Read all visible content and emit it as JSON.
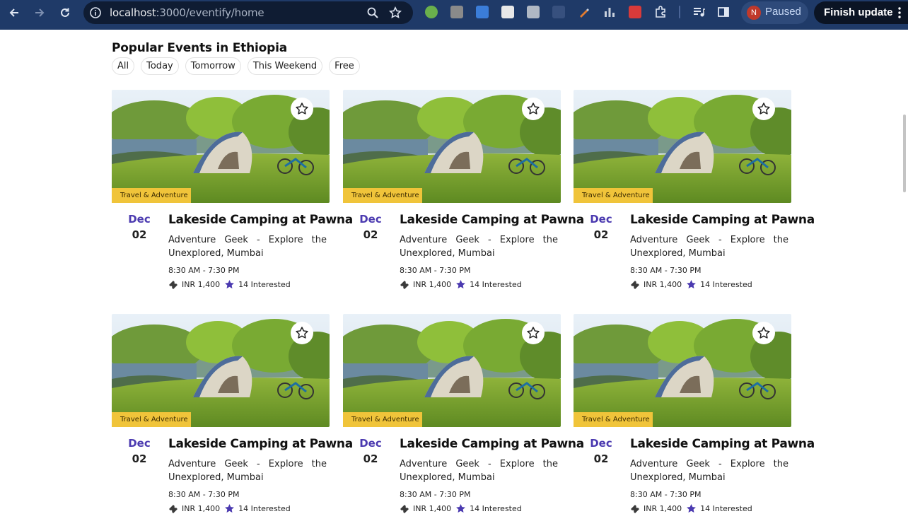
{
  "browser": {
    "url_host": "localhost",
    "url_path": ":3000/eventify/home",
    "profile_initial": "N",
    "profile_status": "Paused",
    "update_button": "Finish update"
  },
  "section": {
    "title": "Popular Events in Ethiopia",
    "filters": [
      "All",
      "Today",
      "Tomorrow",
      "This Weekend",
      "Free"
    ]
  },
  "colors": {
    "accent": "#4b3ab0",
    "category_bg": "#f0c43a",
    "chrome": "#1f3a68"
  },
  "events": [
    {
      "category": "Travel & Adventure",
      "month": "Dec",
      "day": "02",
      "title": "Lakeside Camping at Pawna",
      "organizer": "Adventure Geek - Explore the Unexplored, Mumbai",
      "time": "8:30 AM - 7:30 PM",
      "price": "INR 1,400",
      "interested": "14 Interested"
    },
    {
      "category": "Travel & Adventure",
      "month": "Dec",
      "day": "02",
      "title": "Lakeside Camping at Pawna",
      "organizer": "Adventure Geek - Explore the Unexplored, Mumbai",
      "time": "8:30 AM - 7:30 PM",
      "price": "INR 1,400",
      "interested": "14 Interested"
    },
    {
      "category": "Travel & Adventure",
      "month": "Dec",
      "day": "02",
      "title": "Lakeside Camping at Pawna",
      "organizer": "Adventure Geek - Explore the Unexplored, Mumbai",
      "time": "8:30 AM - 7:30 PM",
      "price": "INR 1,400",
      "interested": "14 Interested"
    },
    {
      "category": "Travel & Adventure",
      "month": "Dec",
      "day": "02",
      "title": "Lakeside Camping at Pawna",
      "organizer": "Adventure Geek - Explore the Unexplored, Mumbai",
      "time": "8:30 AM - 7:30 PM",
      "price": "INR 1,400",
      "interested": "14 Interested"
    },
    {
      "category": "Travel & Adventure",
      "month": "Dec",
      "day": "02",
      "title": "Lakeside Camping at Pawna",
      "organizer": "Adventure Geek - Explore the Unexplored, Mumbai",
      "time": "8:30 AM - 7:30 PM",
      "price": "INR 1,400",
      "interested": "14 Interested"
    },
    {
      "category": "Travel & Adventure",
      "month": "Dec",
      "day": "02",
      "title": "Lakeside Camping at Pawna",
      "organizer": "Adventure Geek - Explore the Unexplored, Mumbai",
      "time": "8:30 AM - 7:30 PM",
      "price": "INR 1,400",
      "interested": "14 Interested"
    }
  ]
}
